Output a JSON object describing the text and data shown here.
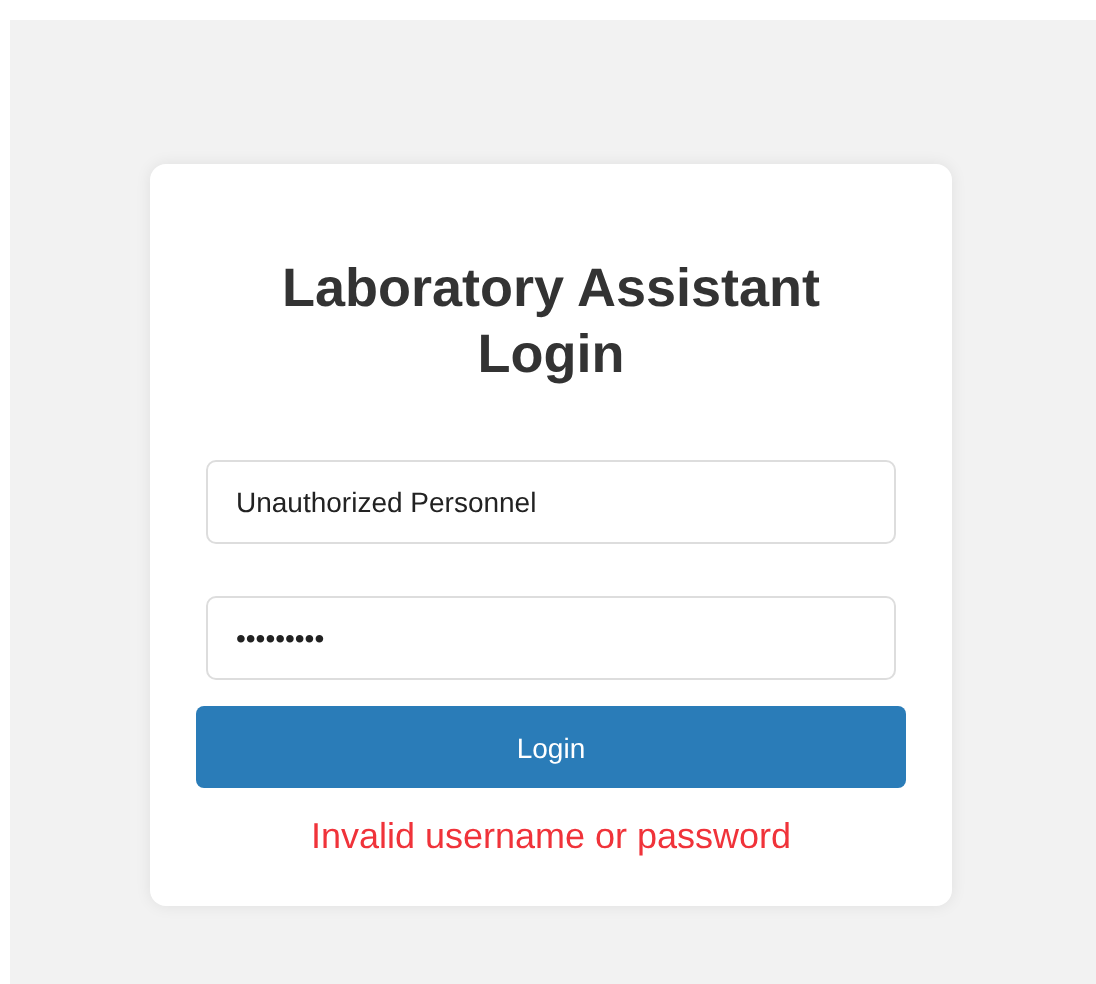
{
  "title": "Laboratory Assistant Login",
  "username": {
    "value": "Unauthorized Personnel"
  },
  "password": {
    "value": "•••••••••"
  },
  "button": "Login",
  "error": "Invalid username or password"
}
